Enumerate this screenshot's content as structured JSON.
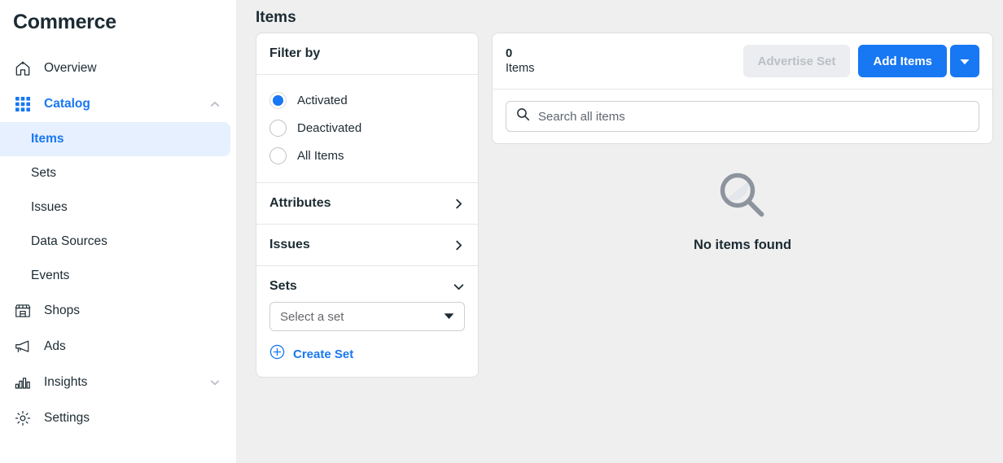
{
  "brand": {
    "title": "Commerce"
  },
  "sidebar": {
    "items": [
      {
        "label": "Overview",
        "icon": "home-icon",
        "type": "parent",
        "chevron": "none",
        "active": false
      },
      {
        "label": "Catalog",
        "icon": "grid-icon",
        "type": "parent",
        "chevron": "chevron-up-icon",
        "active": true
      },
      {
        "label": "Items",
        "type": "sub",
        "selected": true
      },
      {
        "label": "Sets",
        "type": "sub",
        "selected": false
      },
      {
        "label": "Issues",
        "type": "sub",
        "selected": false
      },
      {
        "label": "Data Sources",
        "type": "sub",
        "selected": false
      },
      {
        "label": "Events",
        "type": "sub",
        "selected": false
      },
      {
        "label": "Shops",
        "icon": "storefront-icon",
        "type": "parent",
        "chevron": "none",
        "active": false
      },
      {
        "label": "Ads",
        "icon": "megaphone-icon",
        "type": "parent",
        "chevron": "none",
        "active": false
      },
      {
        "label": "Insights",
        "icon": "bar-chart-icon",
        "type": "parent",
        "chevron": "chevron-down-icon",
        "active": false
      },
      {
        "label": "Settings",
        "icon": "gear-icon",
        "type": "parent",
        "chevron": "none",
        "active": false
      }
    ]
  },
  "page": {
    "title": "Items"
  },
  "filter_panel": {
    "heading": "Filter by",
    "status_options": [
      {
        "label": "Activated",
        "selected": true
      },
      {
        "label": "Deactivated",
        "selected": false
      },
      {
        "label": "All Items",
        "selected": false
      }
    ],
    "sections": [
      {
        "label": "Attributes",
        "state": "collapsed",
        "icon": "chevron-right-icon"
      },
      {
        "label": "Issues",
        "state": "collapsed",
        "icon": "chevron-right-icon"
      },
      {
        "label": "Sets",
        "state": "expanded",
        "icon": "chevron-down-icon"
      }
    ],
    "set_select": {
      "placeholder": "Select a set",
      "value": ""
    },
    "create_set": {
      "label": "Create Set",
      "icon": "plus-circle-icon"
    }
  },
  "items_panel": {
    "count": "0",
    "count_label": "Items",
    "advertise_button": {
      "label": "Advertise Set",
      "disabled": true
    },
    "add_items_button": {
      "label": "Add Items"
    },
    "add_items_caret": {
      "icon": "caret-down-icon"
    },
    "search": {
      "placeholder": "Search all items",
      "value": "",
      "icon": "search-icon"
    },
    "empty_state": {
      "label": "No items found",
      "icon": "magnifier-icon"
    }
  },
  "colors": {
    "accent": "#1877f2",
    "active_nav_bg": "#e7f0fe",
    "page_bg": "#efefef",
    "card_bg": "#ffffff",
    "border": "#dddfe2",
    "disabled_bg": "#ebedf0",
    "disabled_text": "#bcc0c4",
    "empty_icon": "#8d949e",
    "text": "#1c2b33"
  }
}
